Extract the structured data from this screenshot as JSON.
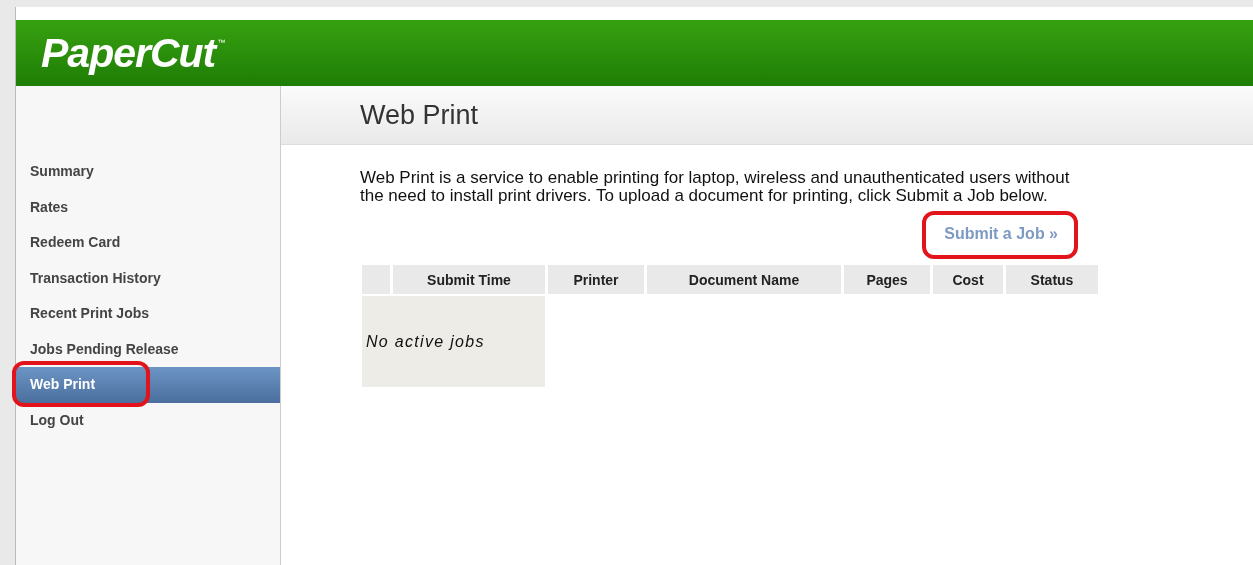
{
  "header": {
    "logo": "PaperCut",
    "trademark": "™"
  },
  "nav": [
    {
      "label": "Summary",
      "selected": false,
      "highlighted": false
    },
    {
      "label": "Rates",
      "selected": false,
      "highlighted": false
    },
    {
      "label": "Redeem Card",
      "selected": false,
      "highlighted": false
    },
    {
      "label": "Transaction History",
      "selected": false,
      "highlighted": false
    },
    {
      "label": "Recent Print Jobs",
      "selected": false,
      "highlighted": false
    },
    {
      "label": "Jobs Pending Release",
      "selected": false,
      "highlighted": false
    },
    {
      "label": "Web Print",
      "selected": true,
      "highlighted": true
    },
    {
      "label": "Log Out",
      "selected": false,
      "highlighted": false
    }
  ],
  "page_title": "Web Print",
  "intro": "Web Print is a service to enable printing for laptop, wireless and unauthenticated users without the need to install print drivers. To upload a document for printing, click Submit a Job below.",
  "submit_link": {
    "label": "Submit a Job »",
    "highlighted": true
  },
  "table": {
    "columns": [
      "",
      "Submit Time",
      "Printer",
      "Document Name",
      "Pages",
      "Cost",
      "Status"
    ],
    "empty_message": "No active jobs"
  }
}
